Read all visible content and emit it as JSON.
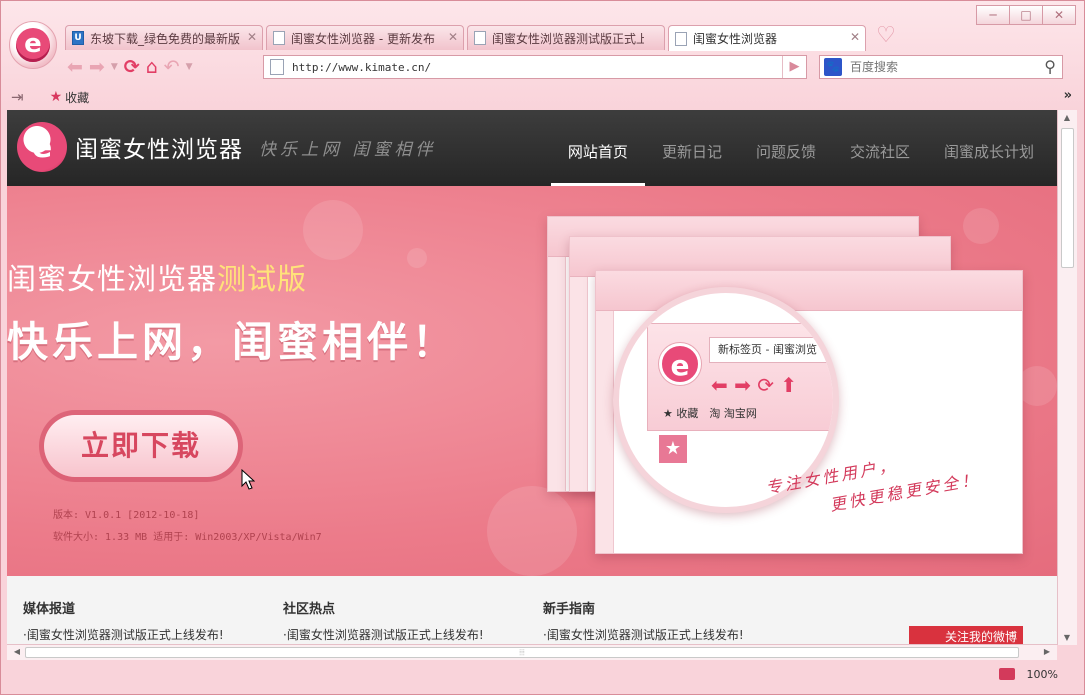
{
  "tabs": [
    {
      "title": "东坡下载_绿色免费的最新版",
      "active": false,
      "fav": "U"
    },
    {
      "title": "闺蜜女性浏览器 - 更新发布",
      "active": false
    },
    {
      "title": "闺蜜女性浏览器测试版正式上",
      "active": false
    },
    {
      "title": "闺蜜女性浏览器",
      "active": true
    }
  ],
  "window_controls": {
    "minimize": "─",
    "maximize": "□",
    "close": "✕"
  },
  "browser_logo_letter": "e",
  "address": {
    "url": "http://www.kimate.cn/"
  },
  "search": {
    "engine_icon": "paw",
    "placeholder": "百度搜索"
  },
  "bookmarks": {
    "favorites_label": "收藏",
    "more": "»"
  },
  "site": {
    "brand_name": "闺蜜女性浏览器",
    "slogan": "快乐上网 闺蜜相伴",
    "nav": [
      {
        "label": "网站首页",
        "active": true
      },
      {
        "label": "更新日记",
        "active": false
      },
      {
        "label": "问题反馈",
        "active": false
      },
      {
        "label": "交流社区",
        "active": false
      },
      {
        "label": "闺蜜成长计划",
        "active": false
      }
    ],
    "banner": {
      "title_main": "闺蜜女性浏览器",
      "title_beta": "测试版",
      "headline": "快乐上网，闺蜜相伴！",
      "download_label": "立即下载",
      "version": "版本: V1.0.1 [2012-10-18]",
      "size": "软件大小: 1.33 MB 适用于: Win2003/XP/Vista/Win7",
      "zoom_tab_title": "新标签页 - 闺蜜浏览",
      "zoom_favorites": "收藏",
      "zoom_taobao": "淘宝网",
      "handwriting_line1": "专注女性用户，",
      "handwriting_line2": "更快更稳更安全！"
    },
    "sections": [
      {
        "title": "媒体报道",
        "item": "·闺蜜女性浏览器测试版正式上线发布!"
      },
      {
        "title": "社区热点",
        "item": "·闺蜜女性浏览器测试版正式上线发布!"
      },
      {
        "title": "新手指南",
        "item": "·闺蜜女性浏览器测试版正式上线发布!"
      }
    ],
    "weibo_label": "关注我的微博"
  },
  "status": {
    "zoom": "100%"
  },
  "colors": {
    "accent": "#e23e65",
    "banner": "#ec7b8a",
    "header": "#2e2e2e"
  }
}
